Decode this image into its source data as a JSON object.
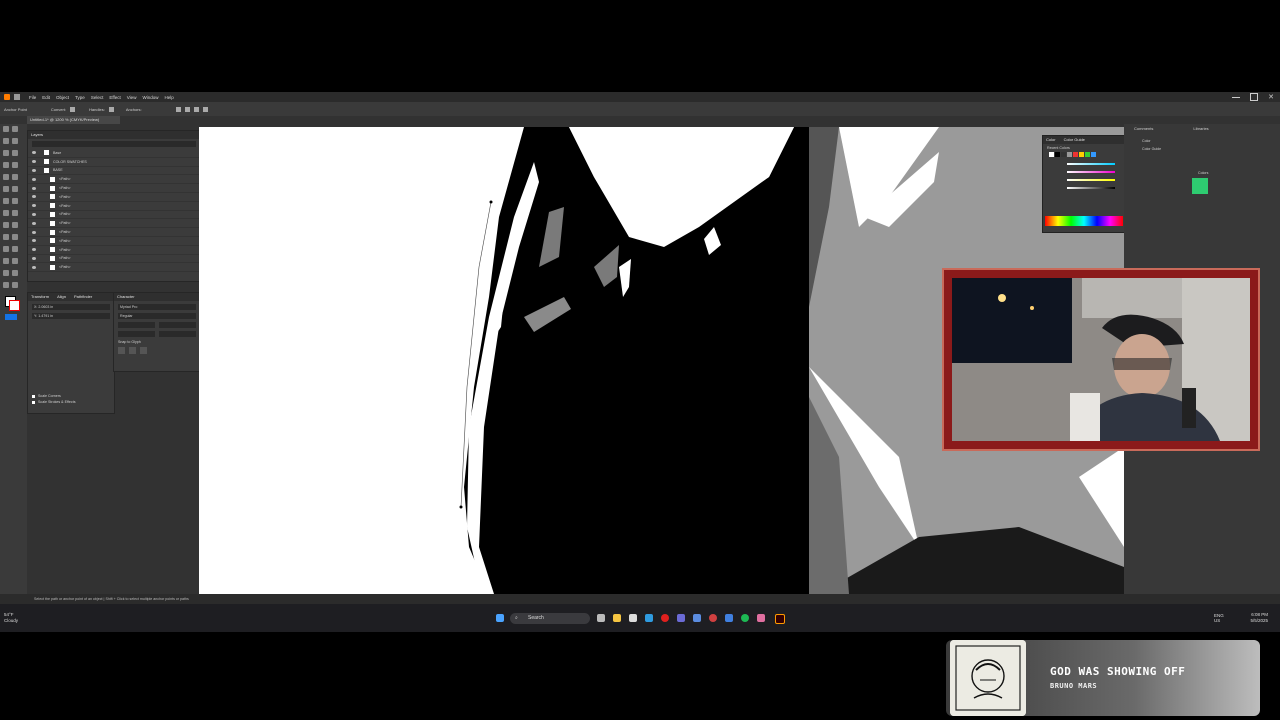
{
  "app": {
    "menu": [
      "File",
      "Edit",
      "Object",
      "Type",
      "Select",
      "Effect",
      "View",
      "Window",
      "Help"
    ],
    "options_bar": [
      "Anchor Point",
      "Convert:",
      "Handles:",
      "Anchors:"
    ],
    "document_tab": "Untitled-1* @ 1200 % (CMYK/Preview)",
    "status_text": "Select the path or anchor point of an object | Shift + Click to select multiple anchor points or paths"
  },
  "layers_panel": {
    "title": "Layers",
    "rows": [
      "Base",
      "COLOR SWATCHES",
      "BASE",
      "<Path>",
      "<Path>",
      "<Path>",
      "<Path>",
      "<Path>",
      "<Path>",
      "<Path>",
      "<Path>",
      "<Path>",
      "<Path>",
      "<Path>"
    ]
  },
  "transform_panel": {
    "tabs": [
      "Transform",
      "Align",
      "Pathfinder"
    ],
    "fields": [
      "X: 2.0603 in",
      "Y: 1.4791 in"
    ],
    "checkboxes": [
      "Scale Corners",
      "Scale Strokes & Effects"
    ]
  },
  "character_panel": {
    "title": "Character",
    "font": "Myriad Pro",
    "style": "Regular",
    "snap_label": "Snap to Glyph"
  },
  "color_panel": {
    "tabs": [
      "Color",
      "Color Guide"
    ],
    "recent": "Recent Colors"
  },
  "right_dock": {
    "tabs": [
      "Comments",
      "Libraries"
    ],
    "items": [
      "Color",
      "Color Guide",
      "Colors"
    ],
    "library_swatch": "#2ecc71"
  },
  "taskbar": {
    "weather_temp": "54°F",
    "weather_desc": "Cloudy",
    "search_label": "Search",
    "clock_time": "6:08 PM",
    "clock_date": "5/5/2025",
    "lang": "ENG US"
  },
  "now_playing": {
    "title": "GOD WAS SHOWING OFF",
    "artist": "BRUNO MARS"
  }
}
